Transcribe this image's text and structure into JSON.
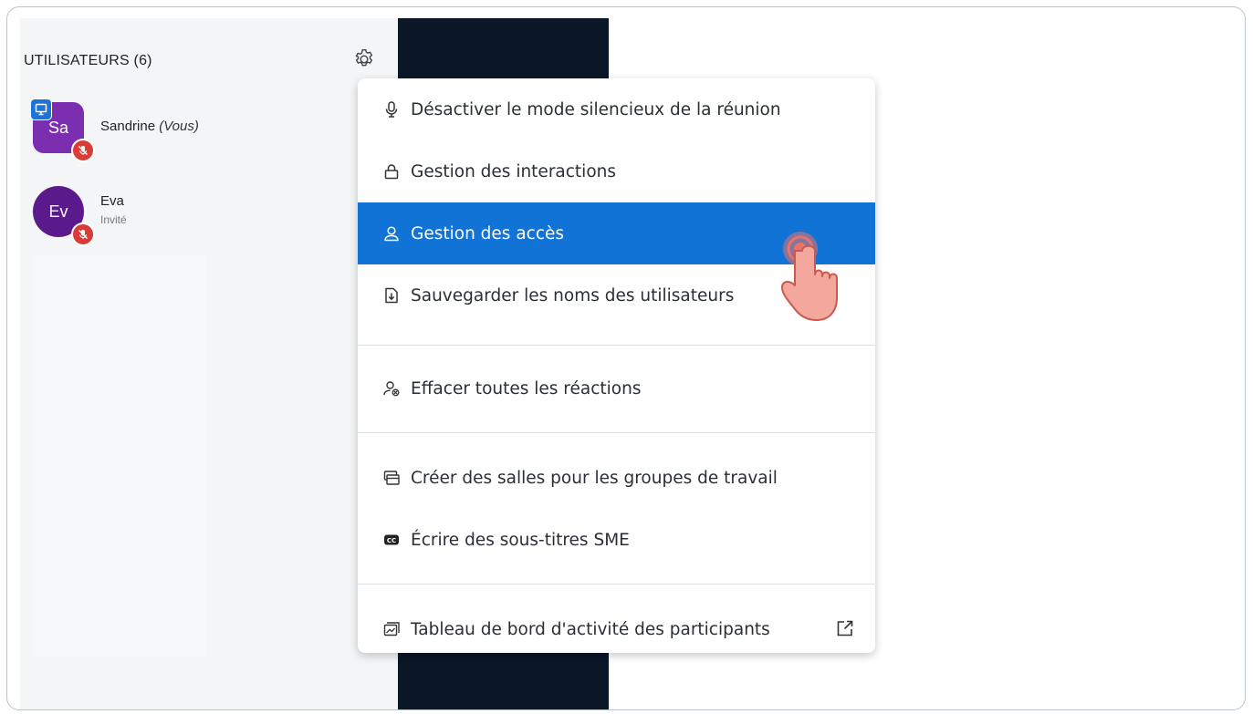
{
  "users_panel": {
    "title": "UTILISATEURS (6)",
    "users": [
      {
        "initials": "Sa",
        "name": "Sandrine",
        "you_label": "(Vous)",
        "role": "",
        "avatar_color": "#7b2fb0",
        "presenter": true,
        "muted": true
      },
      {
        "initials": "Ev",
        "name": "Eva",
        "you_label": "",
        "role": "Invité",
        "avatar_color": "#5a1a8c",
        "presenter": false,
        "muted": true
      }
    ]
  },
  "menu": {
    "items": [
      {
        "label": "Désactiver le mode silencieux de la réunion",
        "icon": "microphone-icon"
      },
      {
        "label": "Gestion des interactions",
        "icon": "lock-icon"
      },
      {
        "label": "Gestion des accès",
        "icon": "user-icon",
        "active": true
      },
      {
        "label": "Sauvegarder les noms des utilisateurs",
        "icon": "download-file-icon"
      },
      {
        "label": "Effacer toutes les réactions",
        "icon": "user-clear-icon"
      },
      {
        "label": "Créer des salles pour les groupes de travail",
        "icon": "rooms-icon"
      },
      {
        "label": "Écrire des sous-titres SME",
        "icon": "closed-captions-icon"
      },
      {
        "label": "Tableau de bord d'activité des participants",
        "icon": "dashboard-icon",
        "external": true
      }
    ]
  },
  "colors": {
    "accent": "#1273d6",
    "dark_strip": "#0b1626",
    "mute_badge": "#d93b37",
    "tap_indicator": "#e8736b"
  }
}
